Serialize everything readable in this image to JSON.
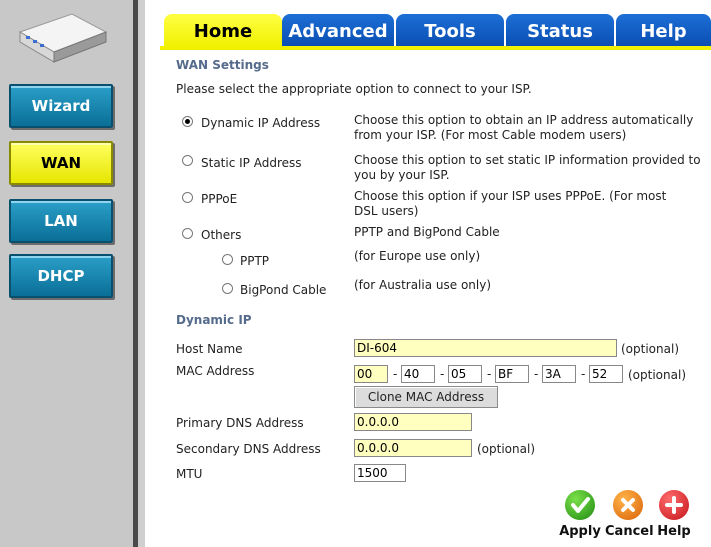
{
  "sidebar": {
    "buttons": [
      {
        "label": "Wizard"
      },
      {
        "label": "WAN"
      },
      {
        "label": "LAN"
      },
      {
        "label": "DHCP"
      }
    ]
  },
  "tabs": [
    {
      "label": "Home"
    },
    {
      "label": "Advanced"
    },
    {
      "label": "Tools"
    },
    {
      "label": "Status"
    },
    {
      "label": "Help"
    }
  ],
  "wan": {
    "title": "WAN Settings",
    "intro": "Please select the appropriate option to connect to your ISP.",
    "options": [
      {
        "label": "Dynamic IP Address",
        "desc1": "Choose this option to obtain an IP address automatically",
        "desc2": "from your ISP. (For most Cable modem users)"
      },
      {
        "label": "Static IP Address",
        "desc1": "Choose this option to set static IP information provided to",
        "desc2": "you by your ISP."
      },
      {
        "label": "PPPoE",
        "desc1": "Choose this option if your ISP uses PPPoE. (For most",
        "desc2": "DSL users)"
      },
      {
        "label": "Others",
        "desc1": "PPTP and BigPond Cable"
      }
    ],
    "sub_options": [
      {
        "label": "PPTP",
        "desc": "(for Europe use only)"
      },
      {
        "label": "BigPond Cable",
        "desc": "(for Australia use only)"
      }
    ],
    "selected": "Dynamic IP Address"
  },
  "dynamic": {
    "title": "Dynamic IP",
    "host_label": "Host Name",
    "host_value": "DI-604",
    "optional": "(optional)",
    "mac_label": "MAC Address",
    "mac": [
      "00",
      "40",
      "05",
      "BF",
      "3A",
      "52"
    ],
    "mac_sep": "-",
    "clone_label": "Clone MAC Address",
    "dns1_label": "Primary DNS Address",
    "dns1_value": "0.0.0.0",
    "dns2_label": "Secondary DNS Address",
    "dns2_value": "0.0.0.0",
    "mtu_label": "MTU",
    "mtu_value": "1500"
  },
  "actions": {
    "apply": "Apply",
    "cancel": "Cancel",
    "help": "Help"
  },
  "colors": {
    "tab_active": "#f0f000",
    "tab_inactive": "#0a4cb0",
    "nav_button": "#0a6f97",
    "field_bg": "#ffffc0"
  }
}
